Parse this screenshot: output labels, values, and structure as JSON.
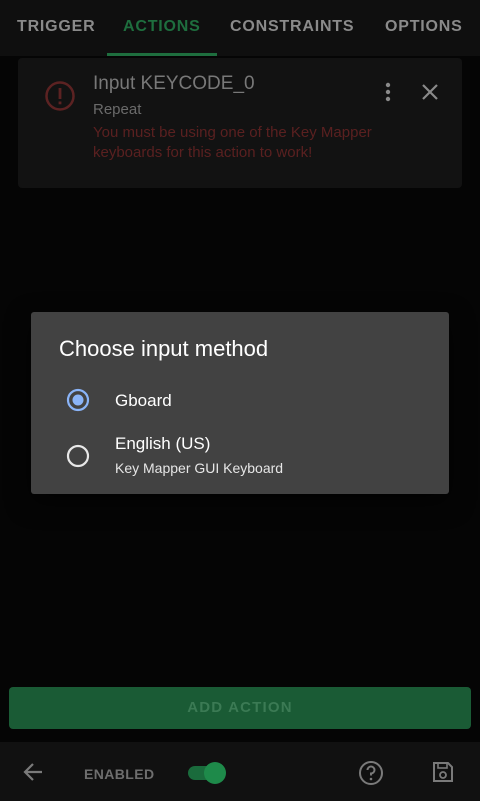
{
  "tabs": [
    {
      "label": "TRIGGER"
    },
    {
      "label": "ACTIONS"
    },
    {
      "label": "CONSTRAINTS"
    },
    {
      "label": "OPTIONS"
    }
  ],
  "action_card": {
    "title": "Input KEYCODE_0",
    "subtitle": "Repeat",
    "error": "You must be using one of the Key Mapper keyboards for this action to work!"
  },
  "dialog": {
    "title": "Choose input method",
    "options": [
      {
        "label": "Gboard",
        "sublabel": "",
        "selected": true
      },
      {
        "label": "English (US)",
        "sublabel": "Key Mapper GUI Keyboard",
        "selected": false
      }
    ]
  },
  "add_action": {
    "label": "ADD ACTION"
  },
  "bottom_bar": {
    "enabled_label": "ENABLED",
    "enabled": true
  },
  "colors": {
    "accent": "#1e6e3e",
    "error": "#5a2020",
    "dialog_bg": "#424242",
    "radio_selected": "#8ab4f8"
  }
}
